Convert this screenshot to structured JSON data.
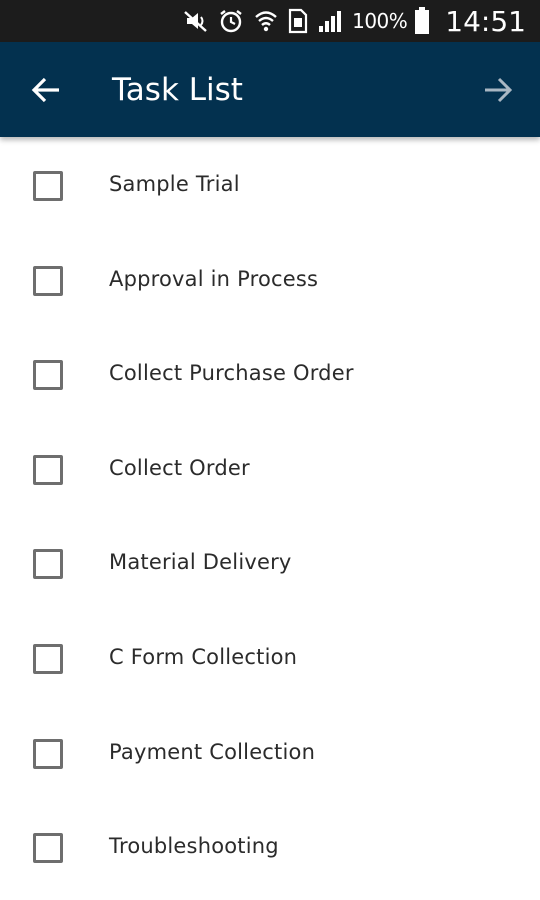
{
  "status_bar": {
    "icons": [
      "mute-icon",
      "alarm-icon",
      "wifi-icon",
      "sim-card-icon",
      "signal-icon",
      "battery-icon"
    ],
    "battery_percent": "100%",
    "time": "14:51"
  },
  "app_bar": {
    "title": "Task List",
    "back_icon": "arrow-left-icon",
    "forward_icon": "arrow-right-icon",
    "background_color": "#03314f"
  },
  "tasks": [
    {
      "label": "Sample Trial",
      "checked": false
    },
    {
      "label": "Approval in Process",
      "checked": false
    },
    {
      "label": "Collect Purchase Order",
      "checked": false
    },
    {
      "label": "Collect Order",
      "checked": false
    },
    {
      "label": "Material Delivery",
      "checked": false
    },
    {
      "label": "C Form Collection",
      "checked": false
    },
    {
      "label": "Payment Collection",
      "checked": false
    },
    {
      "label": "Troubleshooting",
      "checked": false
    }
  ]
}
